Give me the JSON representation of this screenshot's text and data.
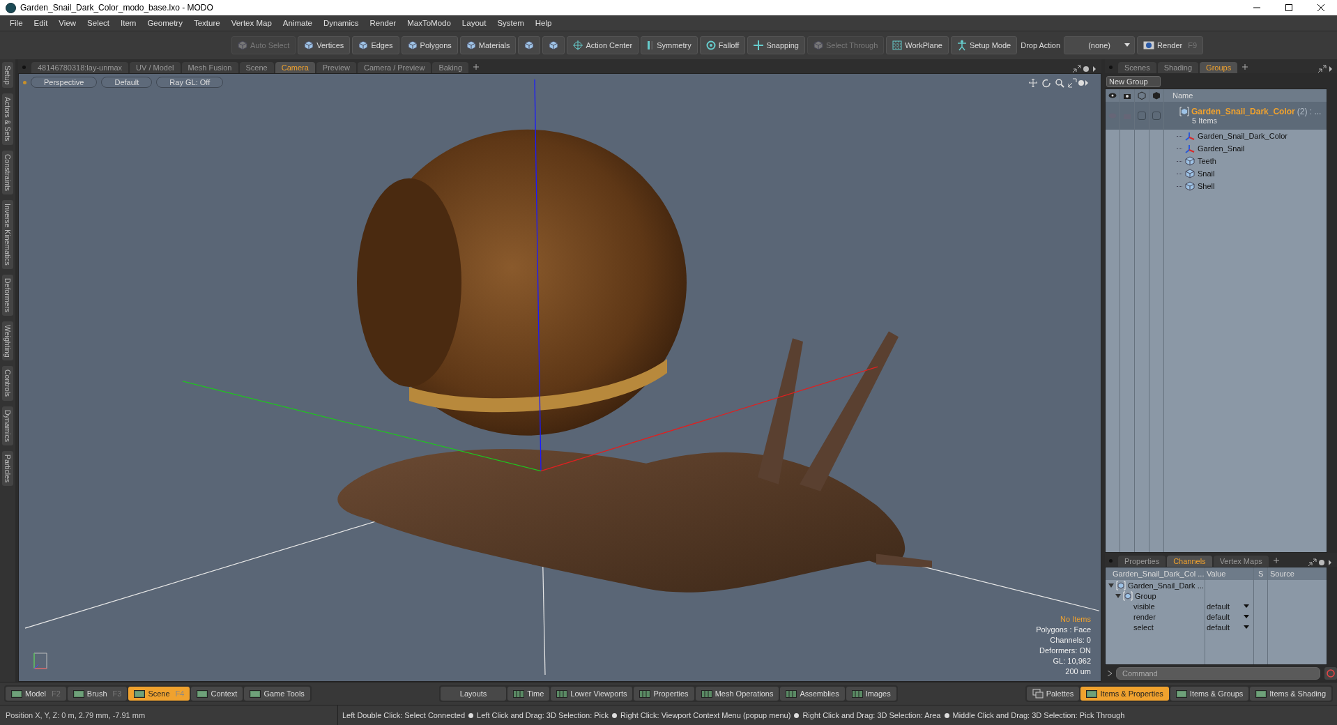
{
  "window": {
    "title": "Garden_Snail_Dark_Color_modo_base.lxo - MODO"
  },
  "menu": [
    "File",
    "Edit",
    "View",
    "Select",
    "Item",
    "Geometry",
    "Texture",
    "Vertex Map",
    "Animate",
    "Dynamics",
    "Render",
    "MaxToModo",
    "Layout",
    "System",
    "Help"
  ],
  "toolbar": [
    {
      "kind": "cube",
      "label": "Auto Select",
      "disabled": true
    },
    {
      "kind": "cube",
      "label": "Vertices",
      "disabled": false
    },
    {
      "kind": "cube",
      "label": "Edges",
      "disabled": false
    },
    {
      "kind": "cube",
      "label": "Polygons",
      "disabled": false
    },
    {
      "kind": "cube",
      "label": "Materials",
      "disabled": false
    },
    {
      "kind": "shield",
      "disabled": false
    },
    {
      "kind": "shield",
      "disabled": false
    },
    {
      "kind": "target",
      "label": "Action Center",
      "disabled": false
    },
    {
      "kind": "bar",
      "label": "Symmetry",
      "disabled": false
    },
    {
      "kind": "ring",
      "label": "Falloff",
      "disabled": false
    },
    {
      "kind": "cross",
      "label": "Snapping",
      "disabled": false
    },
    {
      "kind": "cube",
      "label": "Select Through",
      "disabled": true
    },
    {
      "kind": "grid",
      "label": "WorkPlane",
      "disabled": false
    },
    {
      "kind": "figure",
      "label": "Setup Mode",
      "disabled": false
    },
    {
      "kind": "label",
      "label": "Drop Action"
    },
    {
      "kind": "dropdown",
      "label": "(none)"
    },
    {
      "kind": "render",
      "label": "Render",
      "shortcut": "F9",
      "disabled": false
    }
  ],
  "side_tabs": [
    "Setup",
    "Actors & Sets",
    "Constraints",
    "Inverse Kinematics",
    "Deformers",
    "Weighting",
    "Controls",
    "Dynamics",
    "Particles"
  ],
  "viewport_tabs": [
    {
      "label": "48146780318:lay-unmax",
      "selected": false
    },
    {
      "label": "UV / Model",
      "selected": false
    },
    {
      "label": "Mesh Fusion",
      "selected": false
    },
    {
      "label": "Scene",
      "selected": false
    },
    {
      "label": "Camera",
      "selected": true
    },
    {
      "label": "Preview",
      "selected": false
    },
    {
      "label": "Camera / Preview",
      "selected": false
    },
    {
      "label": "Baking",
      "selected": false
    }
  ],
  "viewport": {
    "header": [
      "Perspective",
      "Default",
      "Ray GL: Off"
    ],
    "info": [
      {
        "text": "No Items",
        "kind": "highlight"
      },
      {
        "text": "Polygons : Face",
        "kind": "plain"
      },
      {
        "text": "Channels: 0",
        "kind": "plain"
      },
      {
        "text": "Deformers: ON",
        "kind": "plain"
      },
      {
        "text": "GL: 10,962",
        "kind": "plain"
      },
      {
        "text": "200 um",
        "kind": "plain"
      }
    ]
  },
  "groups_panel": {
    "tabs": [
      {
        "label": "Scenes",
        "selected": false
      },
      {
        "label": "Shading",
        "selected": false
      },
      {
        "label": "Groups",
        "selected": true
      }
    ],
    "new_group": "New Group",
    "column": "Name",
    "group": {
      "name": "Garden_Snail_Dark_Color",
      "suffix": "(2) : ...",
      "count": "5 Items",
      "expanded": true,
      "children": [
        {
          "name": "Garden_Snail_Dark_Color",
          "kind": "locator"
        },
        {
          "name": "Garden_Snail",
          "kind": "locator"
        },
        {
          "name": "Teeth",
          "kind": "mesh"
        },
        {
          "name": "Snail",
          "kind": "mesh"
        },
        {
          "name": "Shell",
          "kind": "mesh"
        }
      ]
    }
  },
  "channels_panel": {
    "tabs": [
      {
        "label": "Properties",
        "selected": false
      },
      {
        "label": "Channels",
        "selected": true
      },
      {
        "label": "Vertex Maps",
        "selected": false
      }
    ],
    "columns": [
      "Garden_Snail_Dark_Col ...",
      "Value",
      "S",
      "Source"
    ],
    "root": {
      "name": "Garden_Snail_Dark ...",
      "expanded": true
    },
    "group": {
      "name": "Group",
      "expanded": true
    },
    "channels": [
      {
        "name": "visible",
        "value": "default"
      },
      {
        "name": "render",
        "value": "default"
      },
      {
        "name": "select",
        "value": "default"
      }
    ],
    "command": {
      "placeholder": "Command"
    }
  },
  "bottom_left": [
    {
      "label": "Model",
      "shortcut": "F2",
      "selected": false
    },
    {
      "label": "Brush",
      "shortcut": "F3",
      "selected": false
    },
    {
      "label": "Scene",
      "shortcut": "F4",
      "selected": true
    },
    {
      "label": "Context",
      "selected": false
    },
    {
      "label": "Game Tools",
      "selected": false
    }
  ],
  "bottom_middle": [
    {
      "label": "Layouts",
      "kind": "plain"
    },
    {
      "label": "Time",
      "kind": "panel"
    },
    {
      "label": "Lower Viewports",
      "kind": "panel"
    },
    {
      "label": "Properties",
      "kind": "panel"
    },
    {
      "label": "Mesh Operations",
      "kind": "panel"
    },
    {
      "label": "Assemblies",
      "kind": "panel"
    },
    {
      "label": "Images",
      "kind": "panel"
    }
  ],
  "bottom_right": [
    {
      "label": "Palettes",
      "kind": "palette",
      "selected": false
    },
    {
      "label": "Items & Properties",
      "kind": "panel",
      "selected": true
    },
    {
      "label": "Items & Groups",
      "kind": "panel",
      "selected": false
    },
    {
      "label": "Items & Shading",
      "kind": "panel",
      "selected": false
    }
  ],
  "status_bar": {
    "position": "Position X, Y, Z:  0 m, 2.79 mm, -7.91 mm",
    "hints": [
      "Left Double Click: Select Connected",
      "Left Click and Drag: 3D Selection: Pick",
      "Right Click: Viewport Context Menu (popup menu)",
      "Right Click and Drag: 3D Selection: Area",
      "Middle Click and Drag: 3D Selection: Pick Through"
    ]
  }
}
